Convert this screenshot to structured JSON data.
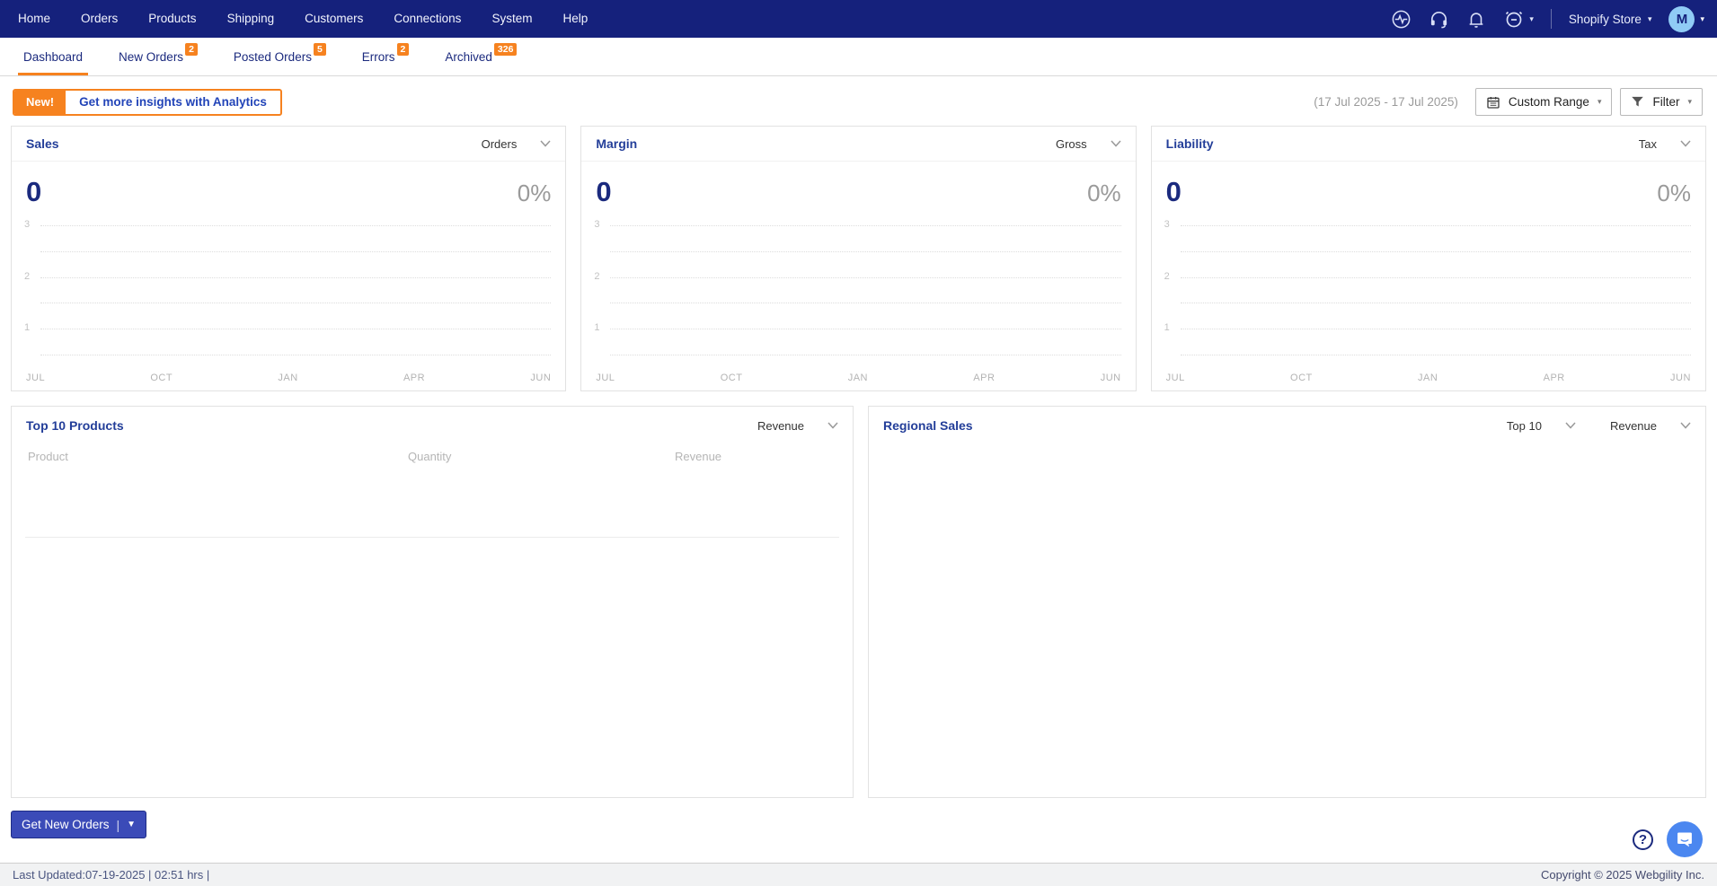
{
  "colors": {
    "navbar_bg": "#15217c",
    "accent_orange": "#f6821f",
    "accent_blue": "#2244b8",
    "navy_text": "#1b2a7e",
    "avatar_bg": "#90cbf5",
    "primary_button_bg": "#3b4bb8",
    "chat_bubble_bg": "#4b87f0"
  },
  "navbar": {
    "items": [
      "Home",
      "Orders",
      "Products",
      "Shipping",
      "Customers",
      "Connections",
      "System",
      "Help"
    ],
    "icons": [
      "activity-icon",
      "headset-icon",
      "bell-icon",
      "alarm-scheduler-icon"
    ],
    "store_selector_label": "Shopify Store",
    "avatar_initial": "M"
  },
  "tabs": [
    {
      "label": "Dashboard",
      "badge": "",
      "active": true
    },
    {
      "label": "New Orders",
      "badge": "2",
      "active": false
    },
    {
      "label": "Posted Orders",
      "badge": "5",
      "active": false
    },
    {
      "label": "Errors",
      "badge": "2",
      "active": false
    },
    {
      "label": "Archived",
      "badge": "326",
      "active": false
    }
  ],
  "toolbar": {
    "new_badge_label": "New!",
    "analytics_button_label": "Get more insights with Analytics",
    "date_range_text": "(17 Jul 2025 - 17 Jul 2025)",
    "custom_range_label": "Custom Range",
    "filter_label": "Filter"
  },
  "metric_cards": [
    {
      "title": "Sales",
      "dropdown": "Orders",
      "value": "0",
      "percent": "0%"
    },
    {
      "title": "Margin",
      "dropdown": "Gross",
      "value": "0",
      "percent": "0%"
    },
    {
      "title": "Liability",
      "dropdown": "Tax",
      "value": "0",
      "percent": "0%"
    }
  ],
  "chart_axis": {
    "x": [
      "JUL",
      "OCT",
      "JAN",
      "APR",
      "JUN"
    ],
    "y": [
      "3",
      "2",
      "1"
    ]
  },
  "top_products": {
    "title": "Top 10 Products",
    "dropdown": "Revenue",
    "columns": [
      "Product",
      "Quantity",
      "Revenue"
    ],
    "rows": []
  },
  "regional_sales": {
    "title": "Regional Sales",
    "dropdown_top": "Top 10",
    "dropdown_metric": "Revenue"
  },
  "actions": {
    "get_new_orders_label": "Get New Orders"
  },
  "footer": {
    "last_updated": "Last Updated:07-19-2025 | 02:51 hrs |",
    "copyright": "Copyright © 2025 Webgility Inc."
  },
  "chart_data": [
    {
      "type": "line",
      "title": "Sales",
      "metric_selector": "Orders",
      "headline_value": 0,
      "headline_percent": "0%",
      "x_ticks": [
        "JUL",
        "OCT",
        "JAN",
        "APR",
        "JUN"
      ],
      "y_ticks": [
        1,
        2,
        3
      ],
      "ylim": [
        0,
        3
      ],
      "grid": "dotted horizontal",
      "legend": "none",
      "series": []
    },
    {
      "type": "line",
      "title": "Margin",
      "metric_selector": "Gross",
      "headline_value": 0,
      "headline_percent": "0%",
      "x_ticks": [
        "JUL",
        "OCT",
        "JAN",
        "APR",
        "JUN"
      ],
      "y_ticks": [
        1,
        2,
        3
      ],
      "ylim": [
        0,
        3
      ],
      "grid": "dotted horizontal",
      "legend": "none",
      "series": []
    },
    {
      "type": "line",
      "title": "Liability",
      "metric_selector": "Tax",
      "headline_value": 0,
      "headline_percent": "0%",
      "x_ticks": [
        "JUL",
        "OCT",
        "JAN",
        "APR",
        "JUN"
      ],
      "y_ticks": [
        1,
        2,
        3
      ],
      "ylim": [
        0,
        3
      ],
      "grid": "dotted horizontal",
      "legend": "none",
      "series": []
    }
  ]
}
